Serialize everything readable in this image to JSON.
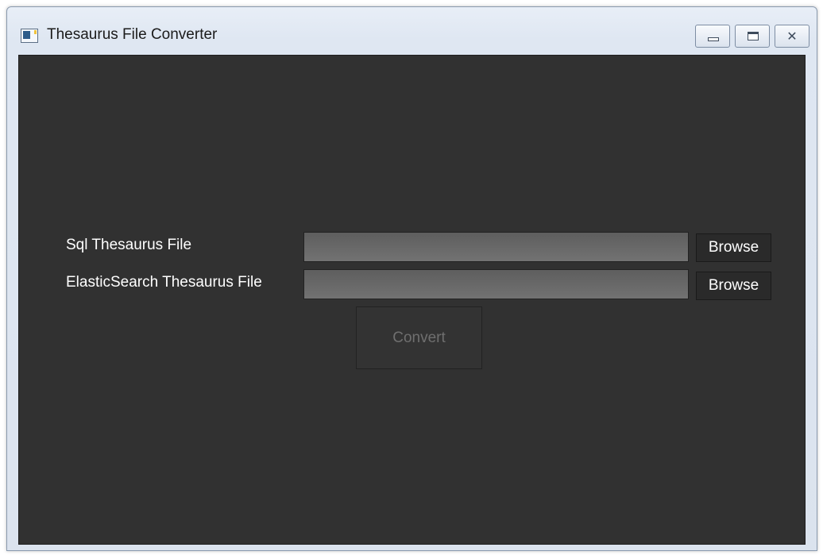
{
  "window": {
    "title": "Thesaurus File Converter",
    "title_icon": "app-window-icon"
  },
  "caption_buttons": {
    "minimize": "minimize-icon",
    "maximize": "maximize-icon",
    "close_glyph": "✕"
  },
  "form": {
    "sql_label": "Sql Thesaurus File",
    "sql_value": "",
    "sql_browse_label": "Browse",
    "es_label": "ElasticSearch Thesaurus File",
    "es_value": "",
    "es_browse_label": "Browse",
    "convert_label": "Convert",
    "convert_enabled": false
  },
  "colors": {
    "client_background": "#313131",
    "label_text": "#ffffff",
    "input_fill": "#6a6a6a",
    "disabled_text": "#6f6f6f"
  }
}
